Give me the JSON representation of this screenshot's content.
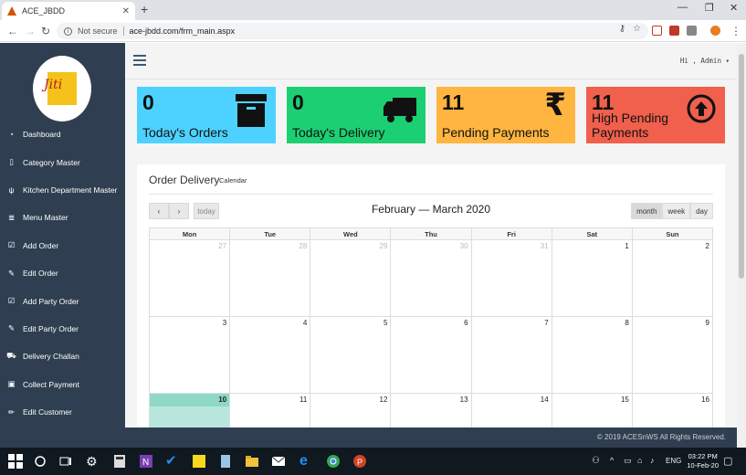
{
  "browser": {
    "tab_title": "ACE_JBDD",
    "security_label": "Not secure",
    "url": "ace-jbdd.com/frm_main.aspx"
  },
  "sidebar": {
    "items": [
      {
        "label": "Dashboard",
        "icon": "dashboard-icon"
      },
      {
        "label": "Category Master",
        "icon": "document-icon"
      },
      {
        "label": "Kitchen Department Master",
        "icon": "cutlery-icon"
      },
      {
        "label": "Menu Master",
        "icon": "menu-list-icon"
      },
      {
        "label": "Add Order",
        "icon": "calendar-check-icon"
      },
      {
        "label": "Edit Order",
        "icon": "edit-icon"
      },
      {
        "label": "Add Party Order",
        "icon": "calendar-check-icon"
      },
      {
        "label": "Edit Party Order",
        "icon": "edit-icon"
      },
      {
        "label": "Delivery Challan",
        "icon": "truck-icon"
      },
      {
        "label": "Collect Payment",
        "icon": "money-icon"
      },
      {
        "label": "Edit Customer",
        "icon": "pencil-icon"
      }
    ]
  },
  "header": {
    "user_label": "Hi , Admin ▾"
  },
  "cards": [
    {
      "value": "0",
      "label": "Today's Orders",
      "color": "#4dd2ff",
      "icon": "archive-box-icon"
    },
    {
      "value": "0",
      "label": "Today's Delivery",
      "color": "#1ccf72",
      "icon": "truck-icon"
    },
    {
      "value": "11",
      "label": "Pending Payments",
      "color": "#ffb540",
      "icon": "rupee-icon"
    },
    {
      "value": "11",
      "label": "High Pending Payments",
      "color": "#f0604d",
      "icon": "arrow-up-circle-icon"
    }
  ],
  "panel": {
    "title": "Order Delivery",
    "subtitle": "Calendar"
  },
  "calendar": {
    "title": "February — March 2020",
    "today_label": "today",
    "views": [
      "month",
      "week",
      "day"
    ],
    "active_view": "month",
    "weekdays": [
      "Mon",
      "Tue",
      "Wed",
      "Thu",
      "Fri",
      "Sat",
      "Sun"
    ],
    "weeks": [
      [
        "27",
        "28",
        "29",
        "30",
        "31",
        "1",
        "2"
      ],
      [
        "3",
        "4",
        "5",
        "6",
        "7",
        "8",
        "9"
      ],
      [
        "10",
        "11",
        "12",
        "13",
        "14",
        "15",
        "16"
      ]
    ]
  },
  "footer": {
    "text": "© 2019 ACESnWS All Rights Reserved."
  },
  "taskbar": {
    "language": "ENG",
    "time": "03:22 PM",
    "date": "10-Feb-20"
  }
}
